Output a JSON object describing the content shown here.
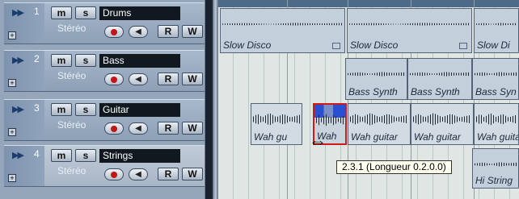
{
  "tracks": [
    {
      "num": "1",
      "name": "Drums",
      "mute": "m",
      "solo": "s",
      "mode": "Stéréo",
      "rec": "R",
      "write": "W"
    },
    {
      "num": "2",
      "name": "Bass",
      "mute": "m",
      "solo": "s",
      "mode": "Stéréo",
      "rec": "R",
      "write": "W"
    },
    {
      "num": "3",
      "name": "Guitar",
      "mute": "m",
      "solo": "s",
      "mode": "Stéréo",
      "rec": "R",
      "write": "W"
    },
    {
      "num": "4",
      "name": "Strings",
      "mute": "m",
      "solo": "s",
      "mode": "Stéréo",
      "rec": "R",
      "write": "W"
    }
  ],
  "expand_glyph": "+",
  "monitor_glyph": "◀",
  "arrow_glyph": "▶▶",
  "parts": {
    "drums": [
      "Slow Disco",
      "Slow Disco",
      "Slow Di"
    ],
    "bass": [
      "Bass Synth",
      "Bass Synth",
      "Bass Syn"
    ],
    "guitar": [
      "Wah gu",
      "Wah",
      "Wah guitar",
      "Wah guitar",
      "Wah guita"
    ],
    "strings": [
      "Hi String"
    ]
  },
  "tooltip": "2.3.1 (Longueur 0.2.0.0)",
  "cursor_glyph": "⇔",
  "colors": {
    "selection": "#d01a1a",
    "tooltip_bg": "#fffff0",
    "name_field_bg": "#111820"
  }
}
